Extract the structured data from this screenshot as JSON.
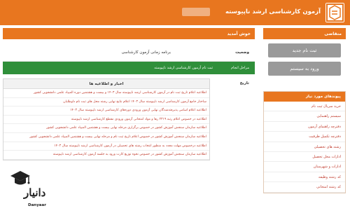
{
  "header": {
    "title": "آزمون کارشناسی ارشد ناپیوسته"
  },
  "sidebar": {
    "heading": "متقاضی",
    "register_button": "ثبت نام جدید",
    "login_button": "ورود به سیستم",
    "links_heading": "پیوندهای مورد نیاز",
    "links": [
      "خرید سریال ثبت نام",
      "سیستم راهنمایی",
      "دفترچه راهنمای آزمون",
      "دفترچه تکمیل ظرفیت",
      "رشته های تحصیلی",
      "ادارات محل تحصیل",
      "ادارات و شهرستان",
      "کد رشته وظیفه",
      "کد رشته امتحانی"
    ]
  },
  "main": {
    "heading": "خوش آمدید",
    "status_label": "وضعیت",
    "status_value": "برنامه زمانی آزمون کارشناسی",
    "action_label": "مراحل انجام",
    "action_value": "ثبت نام آزمون کارشناسی ارشد ناپیوسته",
    "date_label": "تاریخ",
    "news_heading": "اخبار و اطلاعیه ها",
    "news": [
      "اطلاعیه اعلام تاریخ ثبت نام در آزمون کارشناسی ارشد ناپیوسته سال ۱۴۰۳ و بیست و هشتمین دوره المپیاد علمی دانشجویی کشور",
      "ساختار جامع آزمون کارشناسی ارشد ناپیوسته سال ۱۴۰۳ اعلام نتایج نهایی رشته محل های ثبت نام داوطلبان",
      "اطلاعیه اعلام اسامی پذیرفته‌شدگان نهایی آزمون ورودی دوره‌های کارشناسی ارشد ناپیوسته سال ۱۴۰۳",
      "اطلاعیه در خصوص اعلام رتبه ۲۳۱۹ رها و مواد امتحانی آزمون ورودی مقطع کارشناسی ارشد ناپیوسته",
      "اطلاعیه سازمان سنجش آموزش کشور در خصوص برگزاری مرحله نهایی بیست و هشتمین المپیاد علمی دانشجویی کشور",
      "اطلاعیه سازمان سنجش آموزش کشور در خصوص اعلام تاریخ ثبت نام و مرحله نهایی بیست و هشتمین المپیاد علمی دانشجویی کشور",
      "اطلاعیه درخصوص مهلت مجدد به منظور انتخاب رشته های تحصیلی در آزمون کارشناسی ارشد ناپیوسته سال ۱۴۰۳",
      "اطلاعیه سازمان سنجش آموزش کشور در خصوص نحوه توزیع کارت ورود به جلسه آزمون کارشناسی ارشد ناپیوسته"
    ]
  },
  "watermark": {
    "brand": "دانیار",
    "latin": "Danyaar"
  }
}
